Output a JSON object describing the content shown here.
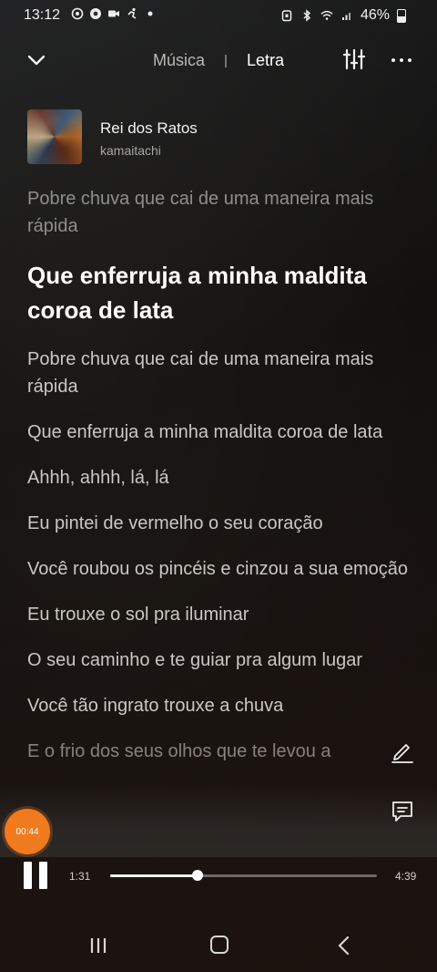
{
  "status_bar": {
    "time": "13:12",
    "battery": "46%",
    "icons": [
      "whatsapp-icon",
      "camera-icon",
      "accessibility-icon",
      "dot-icon",
      "alarm-icon",
      "bluetooth-icon",
      "wifi-icon",
      "signal-icon",
      "battery-icon"
    ]
  },
  "header": {
    "tab_music": "Música",
    "tab_lyrics": "Letra",
    "active_tab": "Letra"
  },
  "song": {
    "title": "Rei dos Ratos",
    "artist": "kamaitachi"
  },
  "lyrics": {
    "lines": [
      "Pobre chuva que cai de uma maneira mais rápida",
      "Que enferruja a minha maldita coroa de lata",
      "Pobre chuva que cai de uma maneira mais rápida",
      "Que enferruja a minha maldita coroa de lata",
      "Ahhh, ahhh, lá, lá",
      "Eu pintei de vermelho o seu coração",
      "Você roubou os pincéis e cinzou a sua emoção",
      "Eu trouxe o sol pra iluminar",
      "O seu caminho e te guiar pra algum lugar",
      "Você tão ingrato trouxe a chuva",
      "E o frio dos seus olhos que te levou a"
    ],
    "active_index": 1
  },
  "floating_timer": "00:44",
  "player": {
    "current_time": "1:31",
    "total_time": "4:39",
    "progress": 0.326,
    "state": "playing"
  },
  "colors": {
    "accent": "#f07a1e",
    "active_lyric": "#ffffff",
    "inactive_lyric": "#c9c8c4"
  }
}
